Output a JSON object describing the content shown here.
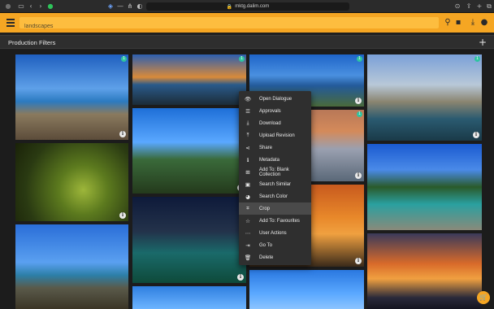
{
  "browser": {
    "url": "mktg.dalim.com",
    "icons": [
      "sidebar-icon",
      "back-icon",
      "forward-icon",
      "shield-icon",
      "lock-icon",
      "download-icon",
      "share-icon",
      "new-tab-icon",
      "tabs-icon"
    ]
  },
  "app_bar": {
    "search_value": "landscapes",
    "color": "#f5a623"
  },
  "filter_bar": {
    "title": "Production Filters",
    "add_label": "+"
  },
  "tiles": [
    {
      "name": "tile-beach-rocks",
      "badge": "1",
      "info": "i"
    },
    {
      "name": "tile-cliff-coast",
      "badge": "1",
      "info": ""
    },
    {
      "name": "tile-harbour-town",
      "badge": "1",
      "info": "i"
    },
    {
      "name": "tile-limestone-cove",
      "badge": "1",
      "info": "i"
    },
    {
      "name": "tile-mountain-valley",
      "badge": "1",
      "info": "i"
    },
    {
      "name": "tile-olive-branch",
      "badge": "",
      "info": "i"
    },
    {
      "name": "tile-forest-river",
      "badge": "1",
      "info": "i"
    },
    {
      "name": "tile-night-marina",
      "badge": "",
      "info": "i"
    },
    {
      "name": "tile-sunset-tree",
      "badge": "",
      "info": "i"
    },
    {
      "name": "tile-hills-sea",
      "badge": "",
      "info": ""
    },
    {
      "name": "tile-cloud-sky",
      "badge": "",
      "info": ""
    },
    {
      "name": "tile-sea-sunset",
      "badge": "",
      "info": ""
    }
  ],
  "context_menu": {
    "items": [
      {
        "label": "Open Dialogue",
        "icon": "eye-icon",
        "glyph": "👁"
      },
      {
        "label": "Approvals",
        "icon": "checklist-icon",
        "glyph": "☰"
      },
      {
        "label": "Download",
        "icon": "download-icon",
        "glyph": "⤓"
      },
      {
        "label": "Upload Revision",
        "icon": "upload-icon",
        "glyph": "⤒"
      },
      {
        "label": "Share",
        "icon": "share-icon",
        "glyph": "⋖"
      },
      {
        "label": "Metadata",
        "icon": "info-icon",
        "glyph": "ℹ"
      },
      {
        "label": "Add To: Blank Collection",
        "icon": "add-collection-icon",
        "glyph": "⊞"
      },
      {
        "label": "Search Similar",
        "icon": "image-search-icon",
        "glyph": "▣"
      },
      {
        "label": "Search Color",
        "icon": "palette-icon",
        "glyph": "◕"
      },
      {
        "label": "Crop",
        "icon": "crop-icon",
        "glyph": "⌗"
      },
      {
        "label": "Add To: Favourites",
        "icon": "star-icon",
        "glyph": "☆"
      },
      {
        "label": "User Actions",
        "icon": "more-icon",
        "glyph": "⋯"
      },
      {
        "label": "Go To",
        "icon": "goto-icon",
        "glyph": "⇥"
      },
      {
        "label": "Delete",
        "icon": "trash-icon",
        "glyph": "🗑"
      }
    ],
    "highlighted": "Crop"
  }
}
